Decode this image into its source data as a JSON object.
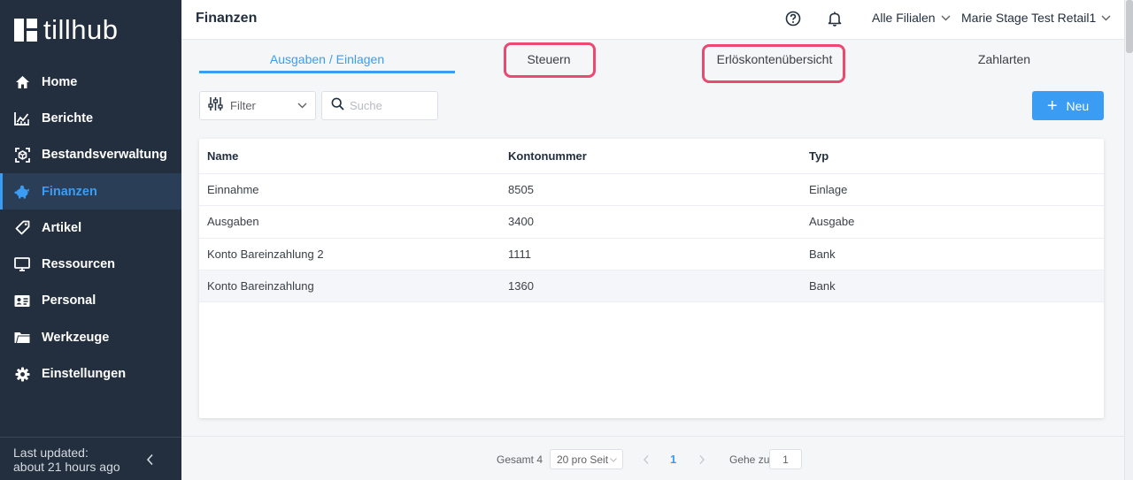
{
  "app": {
    "logo_text": "tillhub"
  },
  "sidebar": {
    "items": [
      {
        "label": "Home",
        "icon": "home-icon",
        "active": false
      },
      {
        "label": "Berichte",
        "icon": "chart-icon",
        "active": false
      },
      {
        "label": "Bestandsverwaltung",
        "icon": "inventory-icon",
        "active": false
      },
      {
        "label": "Finanzen",
        "icon": "piggy-bank-icon",
        "active": true
      },
      {
        "label": "Artikel",
        "icon": "tag-icon",
        "active": false
      },
      {
        "label": "Ressourcen",
        "icon": "monitor-icon",
        "active": false
      },
      {
        "label": "Personal",
        "icon": "id-card-icon",
        "active": false
      },
      {
        "label": "Werkzeuge",
        "icon": "folder-icon",
        "active": false
      },
      {
        "label": "Einstellungen",
        "icon": "gear-icon",
        "active": false
      }
    ],
    "footer": {
      "line1": "Last updated:",
      "line2": "about 21 hours ago"
    }
  },
  "header": {
    "title": "Finanzen",
    "branch_select": "Alle Filialen",
    "user_select": "Marie Stage Test Retail1"
  },
  "tabs": [
    {
      "label": "Ausgaben / Einlagen",
      "active": true
    },
    {
      "label": "Steuern",
      "active": false
    },
    {
      "label": "Erlöskontenübersicht",
      "active": false
    },
    {
      "label": "Zahlarten",
      "active": false
    }
  ],
  "toolbar": {
    "filter_label": "Filter",
    "search_placeholder": "Suche",
    "new_label": "Neu"
  },
  "table": {
    "columns": [
      "Name",
      "Kontonummer",
      "Typ"
    ],
    "rows": [
      {
        "name": "Einnahme",
        "number": "8505",
        "type": "Einlage"
      },
      {
        "name": "Ausgaben",
        "number": "3400",
        "type": "Ausgabe"
      },
      {
        "name": "Konto Bareinzahlung 2",
        "number": "1111",
        "type": "Bank"
      },
      {
        "name": "Konto Bareinzahlung",
        "number": "1360",
        "type": "Bank"
      }
    ]
  },
  "pagination": {
    "total": "Gesamt 4",
    "page_size": "20 pro Seit",
    "current_page": "1",
    "goto_label": "Gehe zu",
    "goto_value": "1"
  },
  "colors": {
    "accent": "#3b9cf4",
    "sidebar_bg": "#232f3e",
    "highlight": "#ea4a72"
  }
}
